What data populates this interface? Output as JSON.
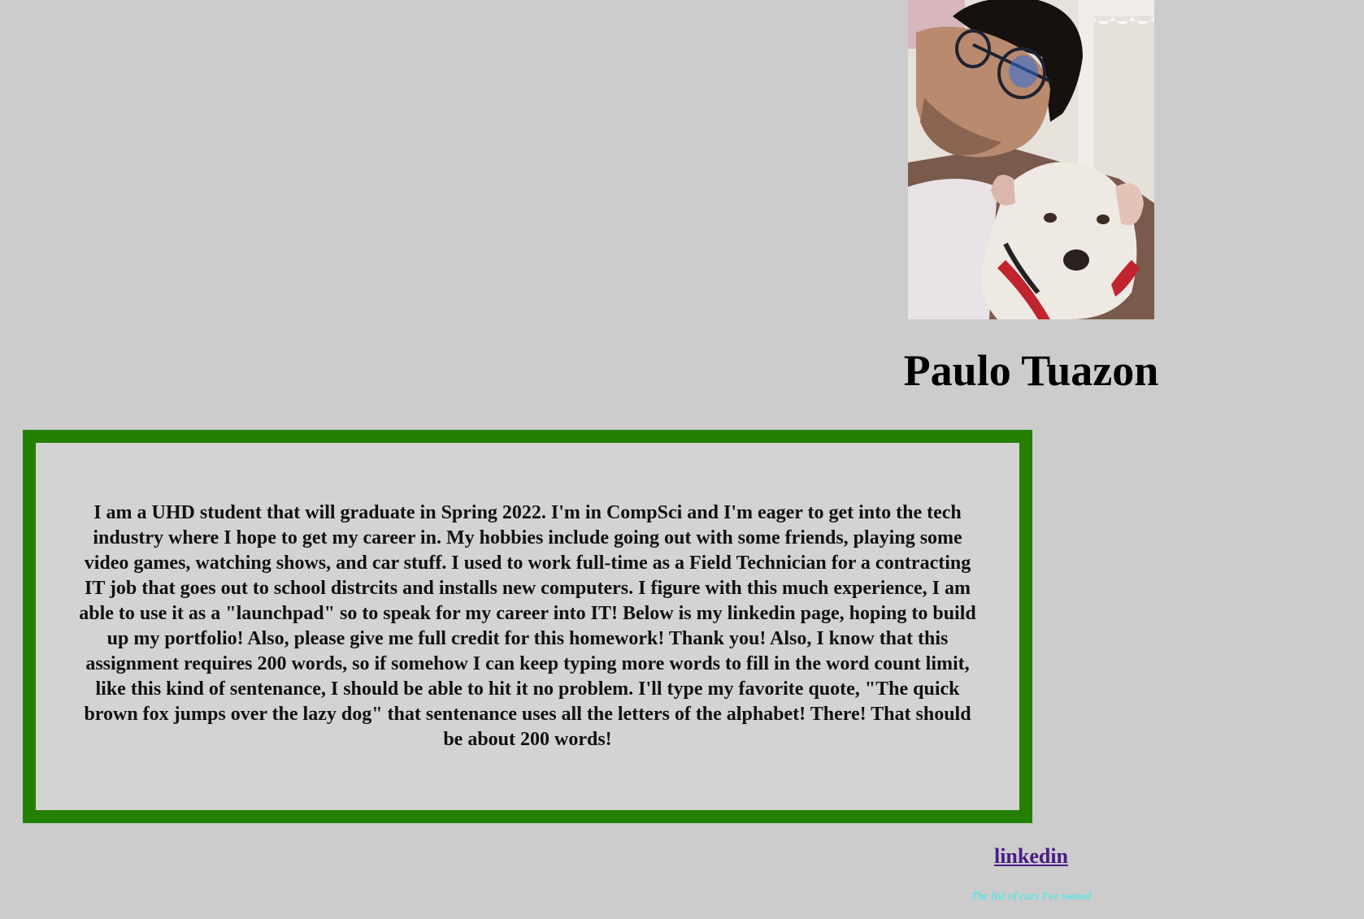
{
  "profile": {
    "photo_alt": "Paulo Tuazon",
    "name": "Paulo Tuazon"
  },
  "bio": {
    "text": "I am a UHD student that will graduate in Spring 2022. I'm in CompSci and I'm eager to get into the tech industry where I hope to get my career in. My hobbies include going out with some friends, playing some video games, watching shows, and car stuff. I used to work full-time as a Field Technician for a contracting IT job that goes out to school distrcits and installs new computers. I figure with this much experience, I am able to use it as a \"launchpad\" so to speak for my career into IT! Below is my linkedin page, hoping to build up my portfolio! Also, please give me full credit for this homework! Thank you! Also, I know that this assignment requires 200 words, so if somehow I can keep typing more words to fill in the word count limit, like this kind of sentenance, I should be able to hit it no problem. I'll type my favorite quote, \"The quick brown fox jumps over the lazy dog\" that sentenance uses all the letters of the alphabet! There! That should be about 200 words!"
  },
  "links": {
    "linkedin_label": "linkedin",
    "cars_label": "The list of cars I've owned"
  },
  "colors": {
    "page_background": "#cccccc",
    "box_border": "#248003",
    "box_background": "#d3d3d3",
    "link_visited": "#4b1b86",
    "cars_text": "#33ecf2"
  }
}
